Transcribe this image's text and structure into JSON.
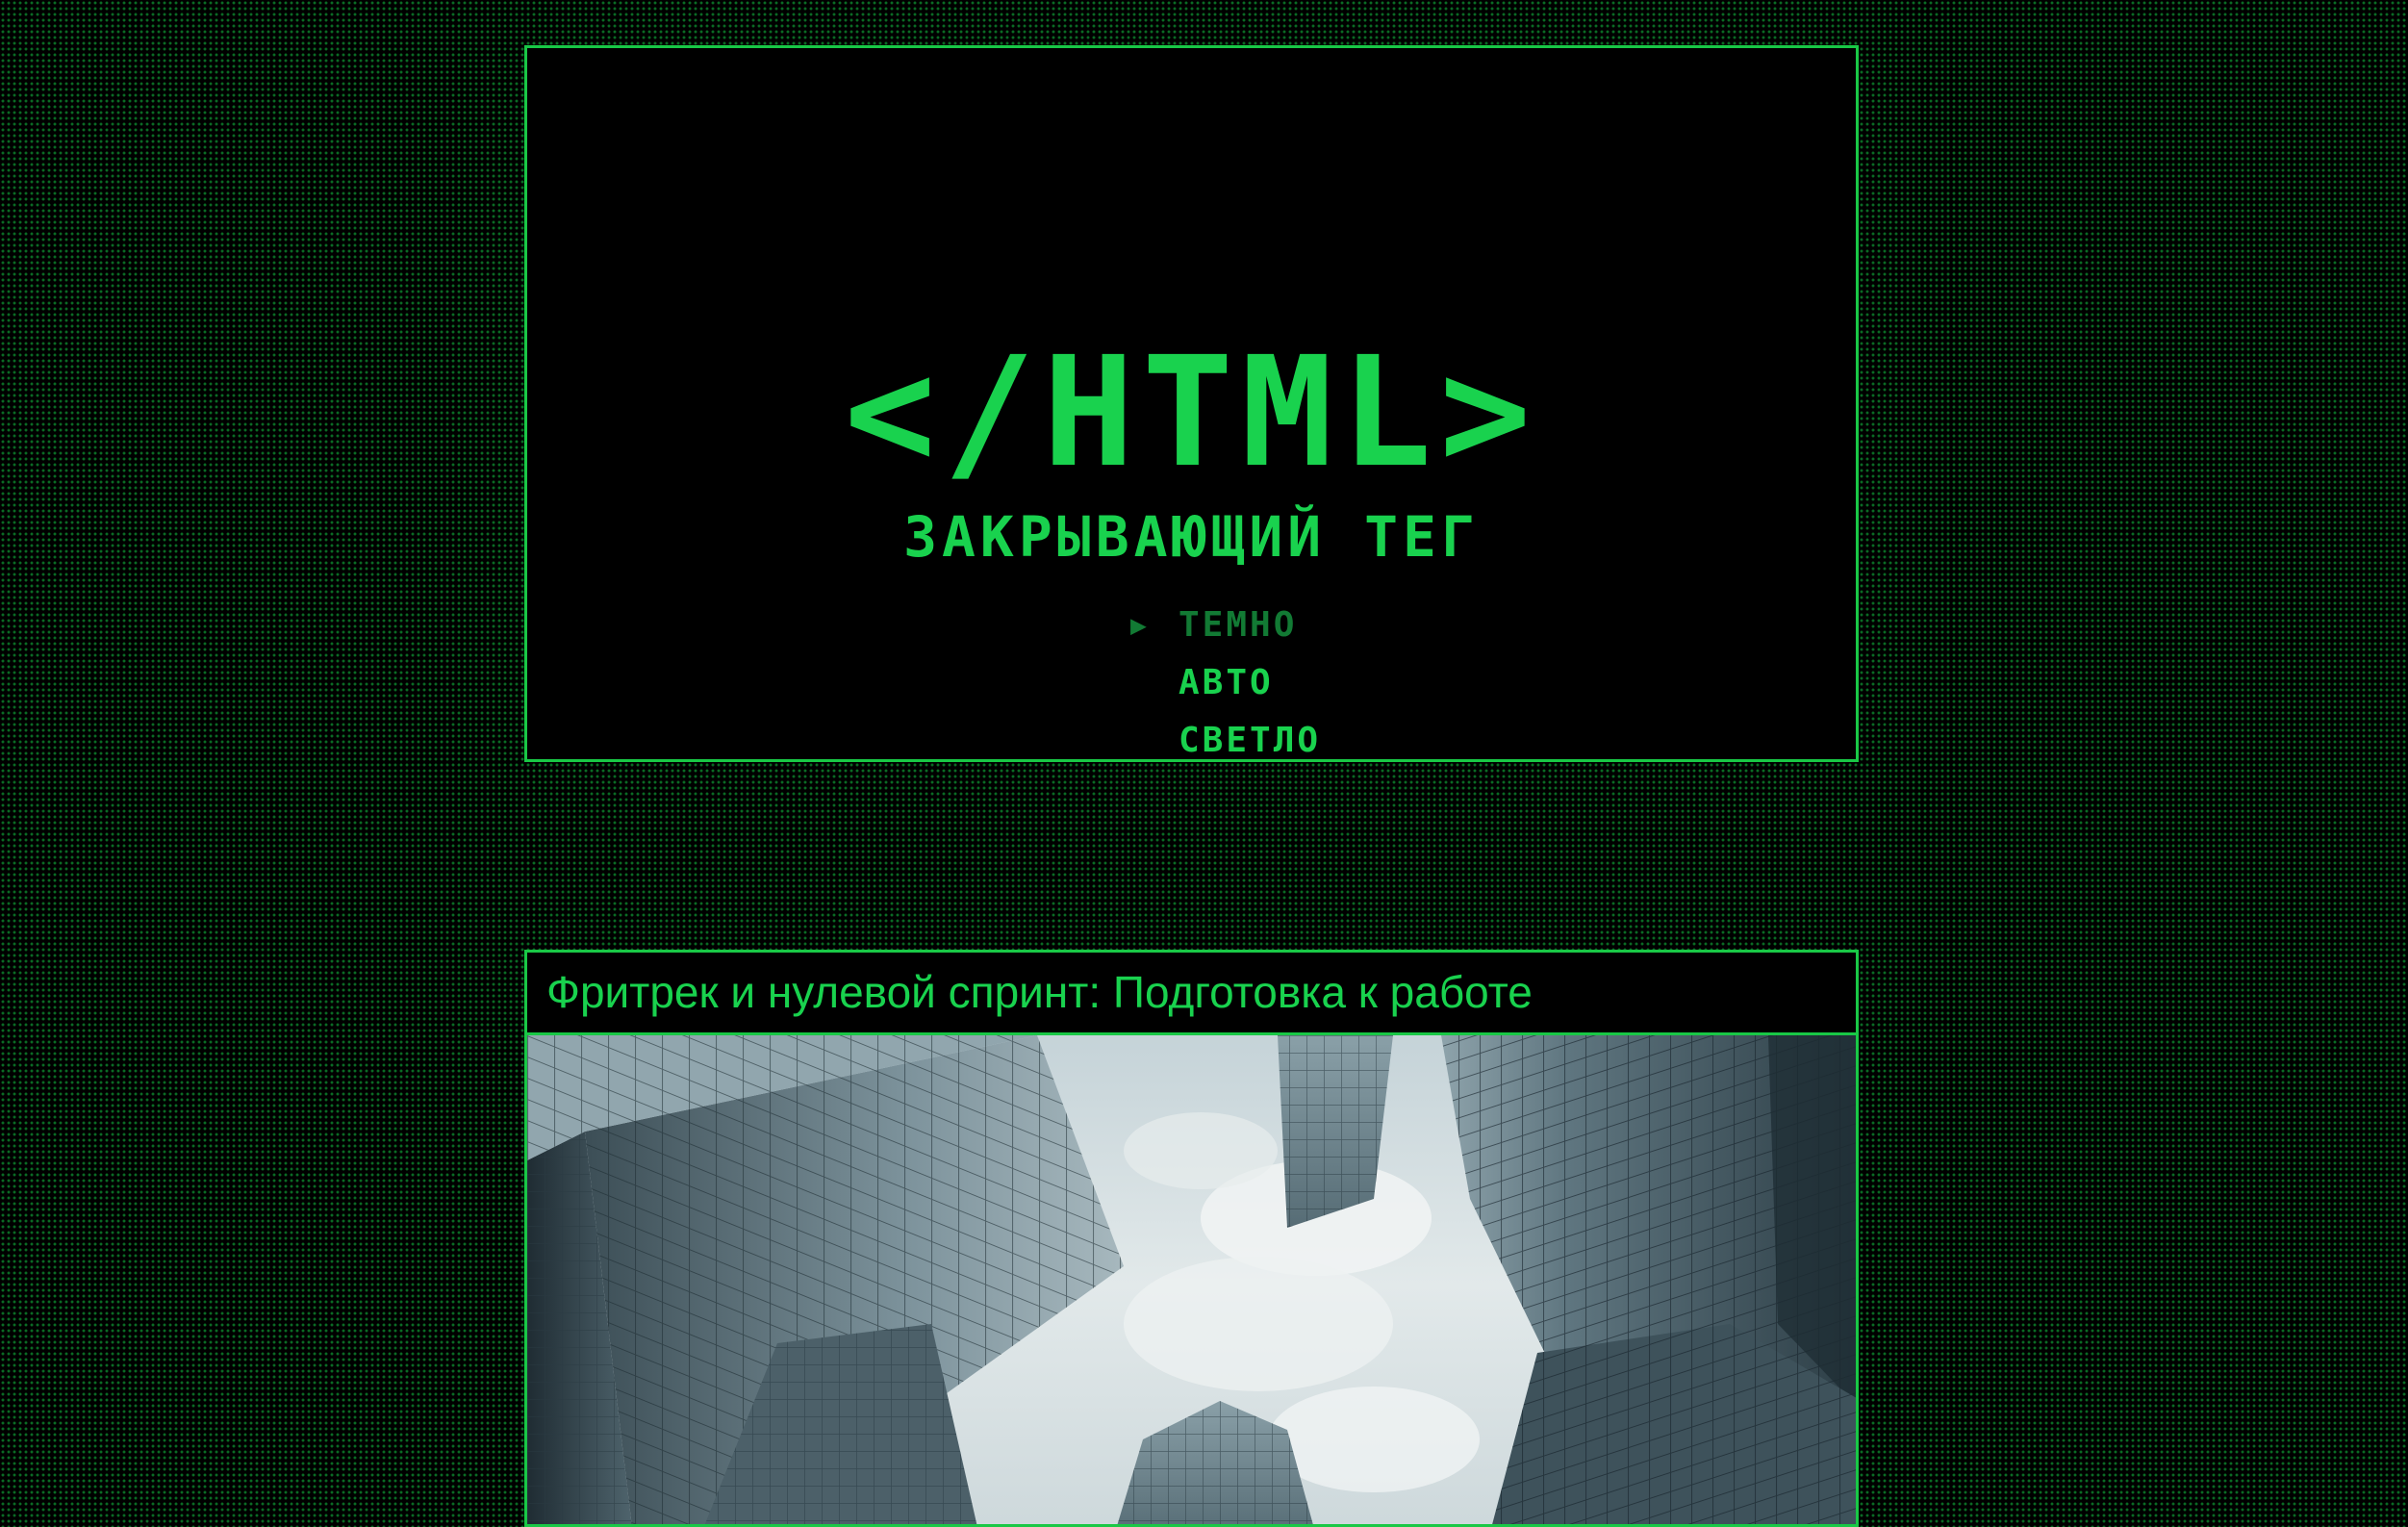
{
  "header": {
    "logo": "</HTML>",
    "subtitle": "ЗАКРЫВАЮЩИЙ ТЕГ"
  },
  "theme_menu": {
    "selected_marker": "▶",
    "options": [
      {
        "label": "ТЕМНО",
        "selected": true
      },
      {
        "label": "АВТО",
        "selected": false
      },
      {
        "label": "СВЕТЛО",
        "selected": false
      }
    ]
  },
  "article": {
    "title": "Фритрек и нулевой спринт: Подготовка к работе",
    "image": "skyscrapers-looking-up-photo"
  },
  "colors": {
    "accent": "#19d24e",
    "accent_dim": "#127a34",
    "border": "#19c846",
    "background": "#000000",
    "dot_pattern": "#0a6a24"
  }
}
